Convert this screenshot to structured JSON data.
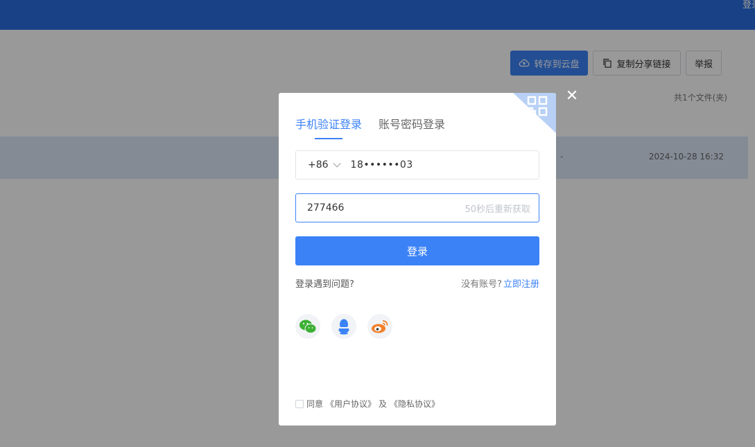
{
  "header": {
    "login_text": "登录"
  },
  "toolbar": {
    "save_to_cloud_label": "转存到云盘",
    "copy_link_label": "复制分享链接",
    "report_label": "举报"
  },
  "file_list": {
    "count_text": "共1个文件(夹)",
    "rows": [
      {
        "size": "-",
        "date": "2024-10-28 16:32"
      }
    ]
  },
  "modal": {
    "tabs": [
      "手机验证登录",
      "账号密码登录"
    ],
    "active_tab": 0,
    "country_code": "+86",
    "phone_value": "18••••••03",
    "code_value": "277466",
    "resend_text": "50秒后重新获取",
    "login_button": "登录",
    "help_link": "登录遇到问题?",
    "no_account_text": "没有账号?",
    "register_link": "立即注册",
    "social_icons": [
      "wechat-icon",
      "qq-icon",
      "weibo-icon"
    ],
    "agreement": {
      "prefix": "同意",
      "user_agreement": "《用户协议》",
      "and": "及",
      "privacy_agreement": "《隐私协议》"
    }
  },
  "colors": {
    "brand": "#3b82f6",
    "topbar": "#2b6ee0",
    "overlay": "rgba(0,0,0,0.4)"
  }
}
